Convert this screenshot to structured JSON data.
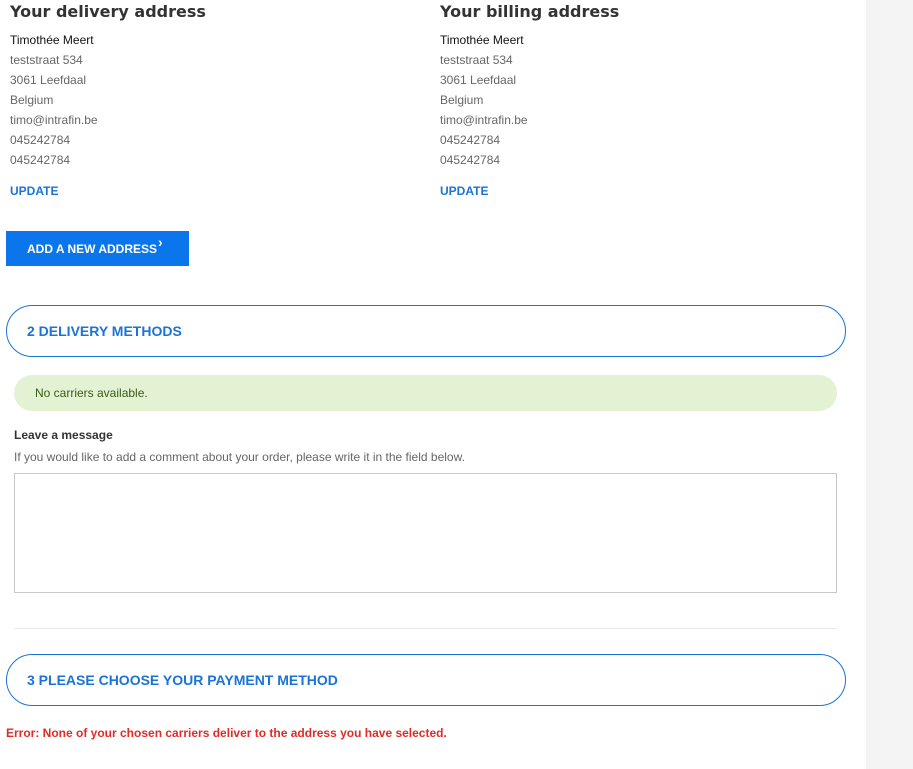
{
  "delivery_address": {
    "title": "Your delivery address",
    "name": "Timothée Meert",
    "street": "teststraat 534",
    "city": "3061 Leefdaal",
    "country": "Belgium",
    "email": "timo@intrafin.be",
    "phone": "045242784",
    "mobile": "045242784",
    "update_label": "UPDATE"
  },
  "billing_address": {
    "title": "Your billing address",
    "name": "Timothée Meert",
    "street": "teststraat 534",
    "city": "3061 Leefdaal",
    "country": "Belgium",
    "email": "timo@intrafin.be",
    "phone": "045242784",
    "mobile": "045242784",
    "update_label": "UPDATE"
  },
  "add_address_button": {
    "label": "ADD A NEW ADDRESS",
    "icon": "chevron-right-icon",
    "glyph": "›"
  },
  "delivery_step": {
    "label": "2 DELIVERY METHODS",
    "notice": "No carriers available."
  },
  "message": {
    "title": "Leave a message",
    "help": "If you would like to add a comment about your order, please write it in the field below.",
    "value": ""
  },
  "payment_step": {
    "label": "3 PLEASE CHOOSE YOUR PAYMENT METHOD"
  },
  "error": {
    "text": "Error: None of your chosen carriers deliver to the address you have selected."
  },
  "colors": {
    "accent": "#1a73d6",
    "button_bg": "#0b75ec",
    "notice_bg": "#e2f2d3",
    "error": "#e02b27"
  }
}
